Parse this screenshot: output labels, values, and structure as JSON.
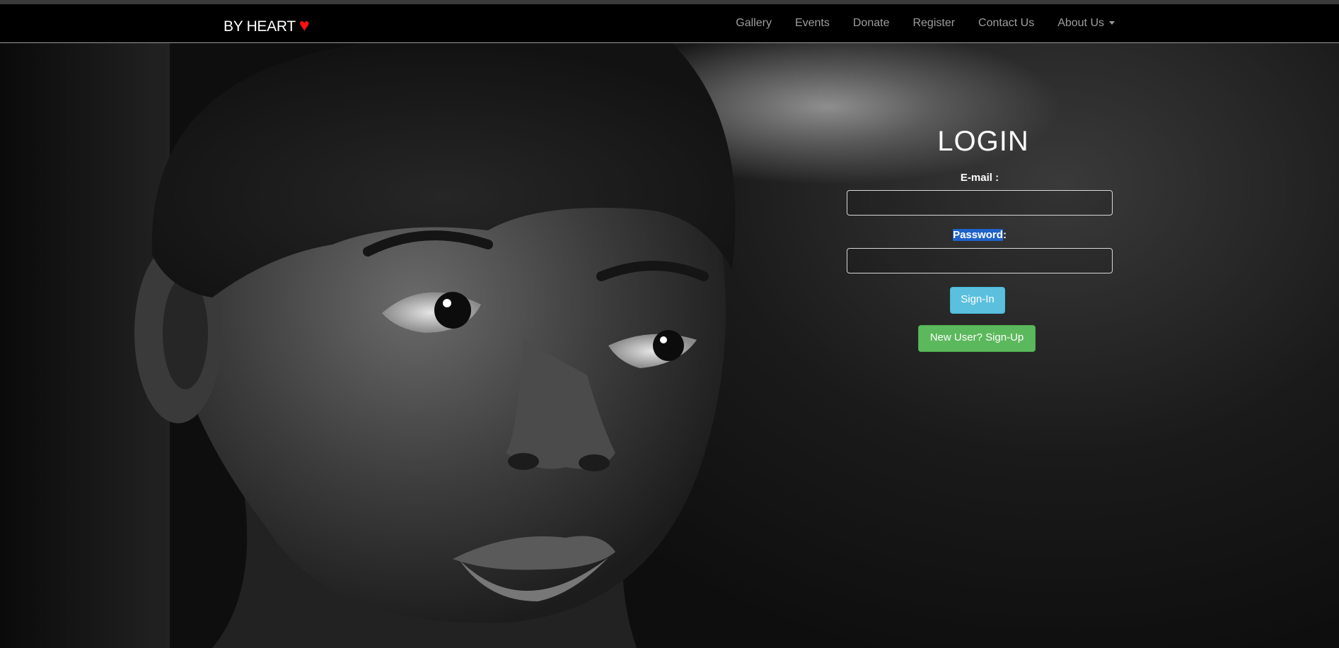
{
  "brand": {
    "name": "BY HEART",
    "heart": "♥"
  },
  "nav": {
    "items": [
      "Gallery",
      "Events",
      "Donate",
      "Register",
      "Contact Us"
    ],
    "dropdown_label": "About Us"
  },
  "login": {
    "title": "LOGIN",
    "email_label": "E-mail :",
    "password_label_selected": "Password",
    "password_label_suffix": ":",
    "email_value": "",
    "password_value": "",
    "signin_label": "Sign-In",
    "signup_label": "New User? Sign-Up"
  },
  "colors": {
    "navbar_bg": "#000000",
    "heart": "#ff1010",
    "signin_button": "#5bc0de",
    "signup_button": "#5cb85c",
    "selection_highlight": "#1e62c9"
  }
}
